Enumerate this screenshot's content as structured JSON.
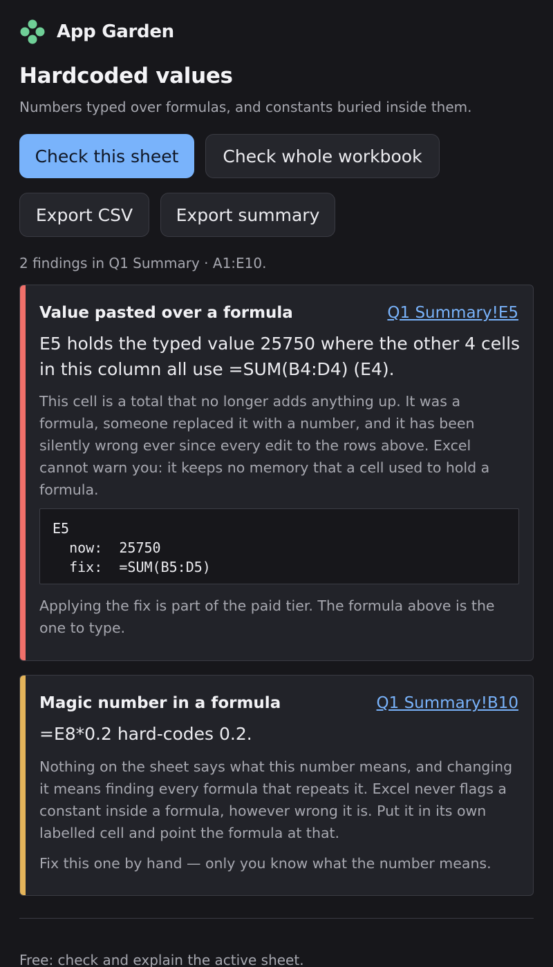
{
  "app": {
    "name": "App Garden",
    "logo_icon": "four-leaf-flower-icon",
    "logo_color": "#6fcf97"
  },
  "page": {
    "title": "Hardcoded values",
    "subtitle": "Numbers typed over formulas, and constants buried inside them."
  },
  "actions": {
    "check_sheet": "Check this sheet",
    "check_workbook": "Check whole workbook",
    "export_csv": "Export CSV",
    "export_summary": "Export summary"
  },
  "status": "2 findings in Q1 Summary · A1:E10.",
  "findings": [
    {
      "severity_color": "#f0706a",
      "title": "Value pasted over a formula",
      "link": "Q1 Summary!E5",
      "summary": "E5 holds the typed value 25750 where the other 4 cells in this column all use =SUM(B4:D4) (E4).",
      "detail": "This cell is a total that no longer adds anything up. It was a formula, someone replaced it with a number, and it has been silently wrong ever since every edit to the rows above. Excel cannot warn you: it keeps no memory that a cell used to hold a formula.",
      "code": {
        "cell": "E5",
        "now_label": "now:",
        "now_value": "25750",
        "fix_label": "fix:",
        "fix_value": "=SUM(B5:D5)"
      },
      "note": "Applying the fix is part of the paid tier. The formula above is the one to type."
    },
    {
      "severity_color": "#e4b45a",
      "title": "Magic number in a formula",
      "link": "Q1 Summary!B10",
      "summary": "=E8*0.2 hard-codes 0.2.",
      "detail": "Nothing on the sheet says what this number means, and changing it means finding every formula that repeats it. Excel never flags a constant inside a formula, however wrong it is. Put it in its own labelled cell and point the formula at that.",
      "note": "Fix this one by hand — only you know what the number means."
    }
  ],
  "footer": {
    "text": "Free: check and explain the active sheet."
  }
}
